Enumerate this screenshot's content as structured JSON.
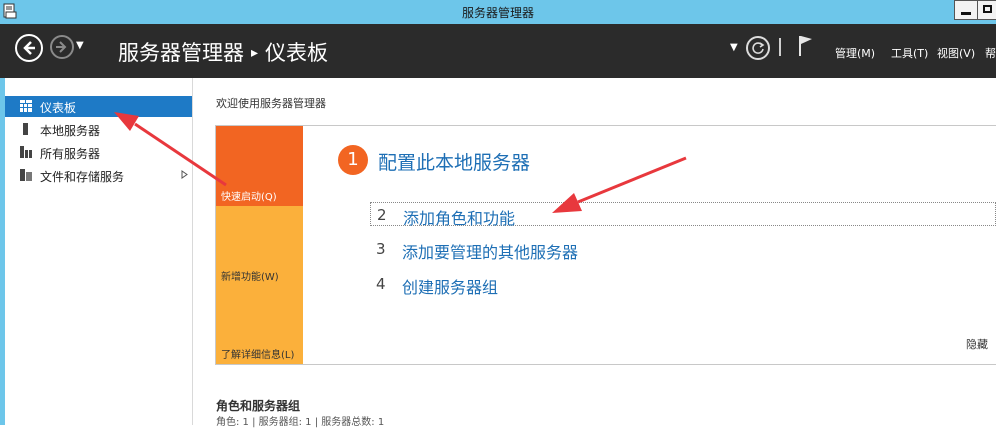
{
  "window": {
    "title": "服务器管理器"
  },
  "breadcrumb": {
    "root": "服务器管理器",
    "current": "仪表板"
  },
  "menus": [
    {
      "label": "管理(M)"
    },
    {
      "label": "工具(T)"
    },
    {
      "label": "视图(V)"
    },
    {
      "label": "帮"
    }
  ],
  "sidebar": {
    "items": [
      {
        "label": "仪表板",
        "icon": "dashboard-grid-icon",
        "active": true
      },
      {
        "label": "本地服务器",
        "icon": "local-server-icon"
      },
      {
        "label": "所有服务器",
        "icon": "all-servers-icon"
      },
      {
        "label": "文件和存储服务",
        "icon": "file-storage-icon",
        "expandable": true
      }
    ]
  },
  "main": {
    "welcome": "欢迎使用服务器管理器",
    "tiles": [
      {
        "label": "快速启动(Q)"
      },
      {
        "label": "新增功能(W)"
      },
      {
        "label": "了解详细信息(L)"
      }
    ],
    "steps": [
      {
        "number": "1",
        "label": "配置此本地服务器"
      },
      {
        "number": "2",
        "label": "添加角色和功能"
      },
      {
        "number": "3",
        "label": "添加要管理的其他服务器"
      },
      {
        "number": "4",
        "label": "创建服务器组"
      }
    ],
    "hide": "隐藏",
    "roles": {
      "title": "角色和服务器组",
      "summary": "角色: 1 | 服务器组: 1 | 服务器总数: 1"
    }
  },
  "colors": {
    "titlebar": "#6dc6ea",
    "toolbar": "#2b2b2b",
    "active_nav": "#1e7ac6",
    "tile_quickstart": "#f26522",
    "tile_secondary": "#fbb03b",
    "link": "#1e6fb5",
    "annotation_arrow": "#e8383d"
  }
}
